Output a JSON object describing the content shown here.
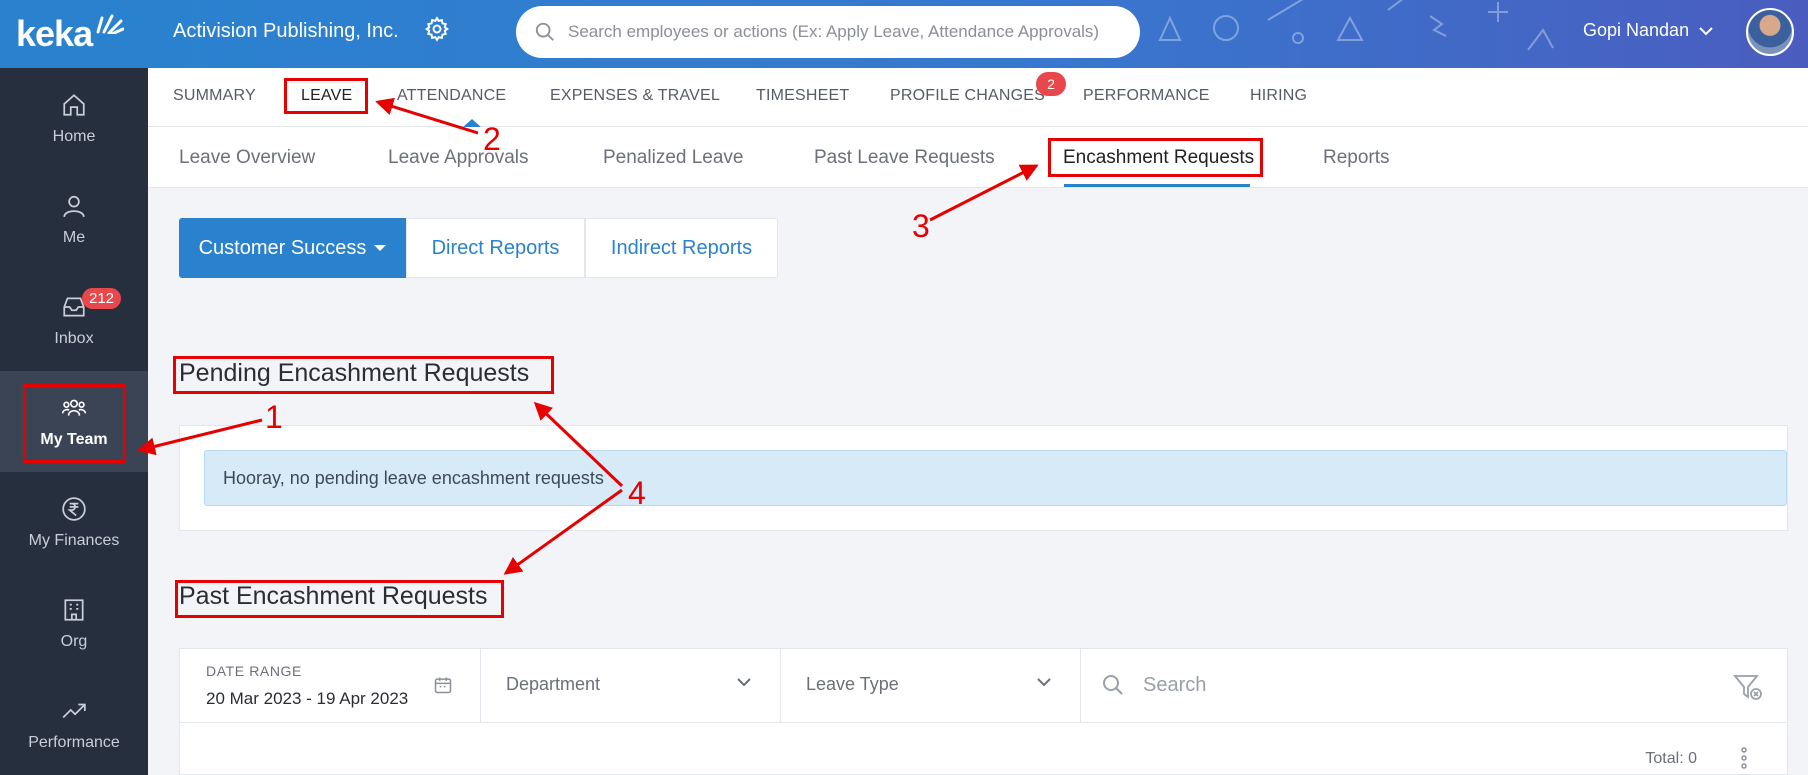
{
  "logo": {
    "text": "keka"
  },
  "sidebar": {
    "items": [
      {
        "label": "Home",
        "icon": "home-icon"
      },
      {
        "label": "Me",
        "icon": "user-icon"
      },
      {
        "label": "Inbox",
        "icon": "inbox-icon",
        "badge": "212"
      },
      {
        "label": "My Team",
        "icon": "team-icon",
        "active": true
      },
      {
        "label": "My Finances",
        "icon": "rupee-icon"
      },
      {
        "label": "Org",
        "icon": "org-icon"
      },
      {
        "label": "Performance",
        "icon": "trend-icon"
      }
    ]
  },
  "header": {
    "company": "Activision Publishing, Inc.",
    "search_placeholder": "Search employees or actions (Ex: Apply Leave, Attendance Approvals)",
    "user_name": "Gopi Nandan"
  },
  "tabs": [
    {
      "label": "SUMMARY"
    },
    {
      "label": "LEAVE",
      "active": true
    },
    {
      "label": "ATTENDANCE"
    },
    {
      "label": "EXPENSES & TRAVEL"
    },
    {
      "label": "TIMESHEET"
    },
    {
      "label": "PROFILE CHANGES",
      "badge": "2"
    },
    {
      "label": "PERFORMANCE"
    },
    {
      "label": "HIRING"
    }
  ],
  "subtabs": [
    {
      "label": "Leave Overview"
    },
    {
      "label": "Leave Approvals"
    },
    {
      "label": "Penalized Leave"
    },
    {
      "label": "Past Leave Requests"
    },
    {
      "label": "Encashment Requests",
      "active": true
    },
    {
      "label": "Reports"
    }
  ],
  "segment": {
    "primary": "Customer Success",
    "direct": "Direct Reports",
    "indirect": "Indirect Reports"
  },
  "pending": {
    "title": "Pending Encashment Requests",
    "empty_message": "Hooray, no pending leave encashment requests"
  },
  "past": {
    "title": "Past Encashment Requests",
    "date_range_label": "DATE RANGE",
    "date_range_value": "20 Mar 2023 - 19 Apr 2023",
    "department_placeholder": "Department",
    "leave_type_placeholder": "Leave Type",
    "search_placeholder": "Search",
    "total": "Total: 0"
  },
  "annotations": [
    "1",
    "2",
    "3",
    "4"
  ],
  "colors": {
    "brand": "#2a82cf",
    "sidebar": "#262f3d",
    "annotation": "#e60000"
  }
}
